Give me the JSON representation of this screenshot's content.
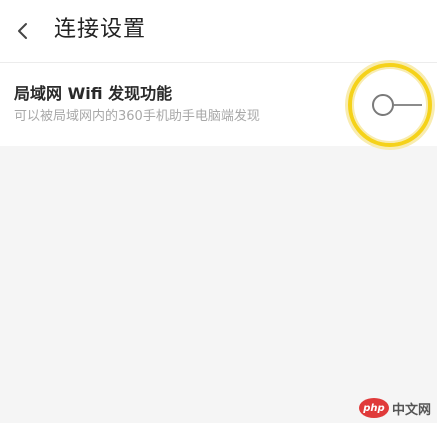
{
  "header": {
    "back_icon": "chevron-left-icon",
    "title": "连接设置"
  },
  "setting": {
    "title": "局域网 Wifi 发现功能",
    "description": "可以被局域网内的360手机助手电脑端发现",
    "toggle_state": "off"
  },
  "watermark": {
    "logo_text": "php",
    "text": "中文网"
  },
  "colors": {
    "highlight": "#f5d21a",
    "toggle_stroke": "#8c8c8c",
    "watermark_logo": "#e03a3a"
  }
}
